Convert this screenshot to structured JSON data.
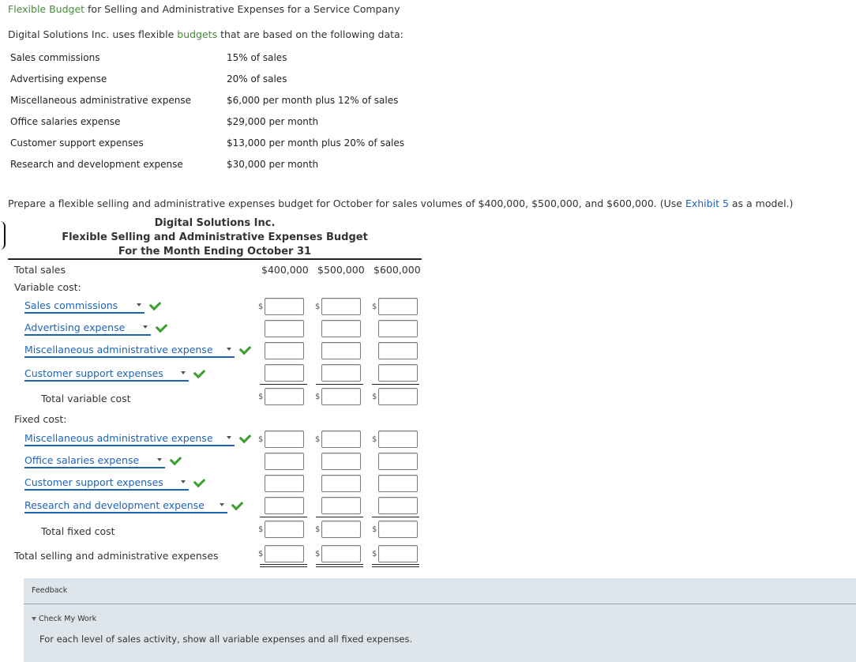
{
  "header": {
    "title_link": "Flexible Budget",
    "title_rest": " for Selling and Administrative Expenses for a Service Company",
    "intro_pre": "Digital Solutions Inc. uses flexible ",
    "intro_link": "budgets",
    "intro_post": " that are based on the following data:"
  },
  "data_table": [
    {
      "label": "Sales commissions",
      "value": "15% of sales"
    },
    {
      "label": "Advertising expense",
      "value": "20% of sales"
    },
    {
      "label": "Miscellaneous administrative expense",
      "value": "$6,000 per month plus 12% of sales"
    },
    {
      "label": "Office salaries expense",
      "value": "$29,000 per month"
    },
    {
      "label": "Customer support expenses",
      "value": "$13,000 per month plus 20% of sales"
    },
    {
      "label": "Research and development expense",
      "value": "$30,000 per month"
    }
  ],
  "prompt": {
    "pre": "Prepare a flexible selling and administrative expenses budget for October for sales volumes of $400,000, $500,000, and $600,000. (Use ",
    "link": "Exhibit 5",
    "post": " as a model.)"
  },
  "budget": {
    "company": "Digital Solutions Inc.",
    "title": "Flexible Selling and Administrative Expenses Budget",
    "period": "For the Month Ending October 31",
    "total_sales_label": "Total sales",
    "columns": [
      "$400,000",
      "$500,000",
      "$600,000"
    ],
    "variable_label": "Variable cost:",
    "variable_items": [
      "Sales commissions",
      "Advertising expense",
      "Miscellaneous administrative expense",
      "Customer support expenses"
    ],
    "total_variable_label": "Total variable cost",
    "fixed_label": "Fixed cost:",
    "fixed_items": [
      "Miscellaneous administrative expense",
      "Office salaries expense",
      "Customer support expenses",
      "Research and development expense"
    ],
    "total_fixed_label": "Total fixed cost",
    "grand_total_label": "Total selling and administrative expenses",
    "dollar_sign": "$"
  },
  "feedback": {
    "title": "Feedback",
    "check_label": "Check My Work",
    "text": "For each level of sales activity, show all variable expenses and all fixed expenses."
  },
  "colors": {
    "accent_green": "#4a8a3d",
    "link_blue": "#1f63b4",
    "check_green": "#3aa02e",
    "feedback_bg": "#dfe6eb"
  }
}
